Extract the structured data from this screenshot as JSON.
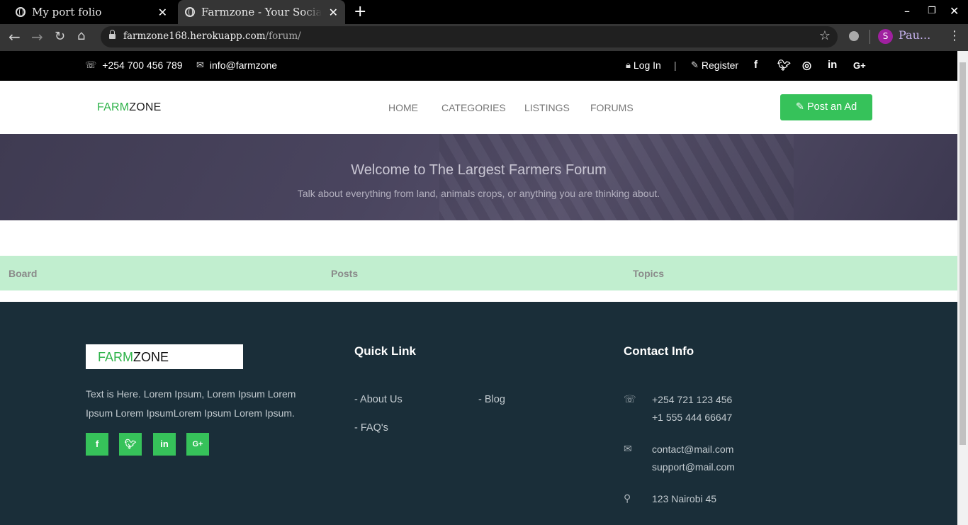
{
  "browser": {
    "tabs": [
      {
        "title": "My port folio",
        "active": false
      },
      {
        "title": "Farmzone - Your Social Media",
        "active": true
      }
    ],
    "url_host": "farmzone168.herokuapp.com",
    "url_path": "/forum/",
    "profile_initial": "S",
    "profile_name": "Pau..."
  },
  "topbar": {
    "phone": "+254 700 456 789",
    "email": "info@farmzone",
    "login": "Log In",
    "separator": "|",
    "register": "Register",
    "social": [
      "facebook-icon",
      "twitter-icon",
      "instagram-icon",
      "linkedin-icon",
      "google-plus-icon"
    ]
  },
  "header": {
    "logo_green": "FARM",
    "logo_dark": "ZONE",
    "nav": [
      "HOME",
      "CATEGORIES",
      "LISTINGS",
      "FORUMS"
    ],
    "post_ad": "Post an Ad"
  },
  "hero": {
    "title": "Welcome to The Largest Farmers Forum",
    "subtitle": "Talk about everything from land, animals crops, or anything you are thinking about."
  },
  "board": {
    "columns": [
      "Board",
      "Posts",
      "Topics"
    ]
  },
  "footer": {
    "logo_green": "FARM",
    "logo_dark": "ZONE",
    "text": "Text is Here. Lorem Ipsum, Lorem Ipsum Lorem Ipsum Lorem IpsumLorem Ipsum Lorem Ipsum.",
    "quick_link_title": "Quick Link",
    "links": [
      "- About Us",
      "- Blog",
      "- FAQ's"
    ],
    "contact_title": "Contact Info",
    "phone1": "+254 721 123 456",
    "phone2": "+1 555 444 66647",
    "email1": "contact@mail.com",
    "email2": "support@mail.com",
    "address": "123 Nairobi 45"
  },
  "colors": {
    "brand_green": "#36c25a",
    "footer_bg": "#1a2e39",
    "board_header_bg": "#c1eecf"
  }
}
